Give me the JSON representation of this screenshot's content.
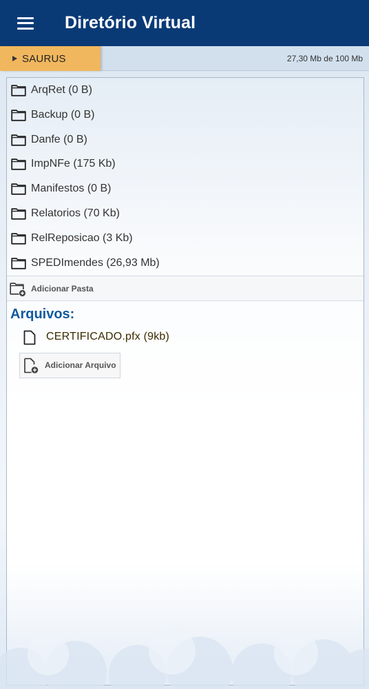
{
  "header": {
    "title": "Diretório Virtual",
    "menu_icon": "hamburger-menu-icon"
  },
  "subbar": {
    "current": "SAURUS",
    "quota": "27,30 Mb de 100 Mb"
  },
  "folders": [
    {
      "label": "ArqRet (0 B)"
    },
    {
      "label": "Backup (0 B)"
    },
    {
      "label": "Danfe (0 B)"
    },
    {
      "label": "ImpNFe (175 Kb)"
    },
    {
      "label": "Manifestos (0 B)"
    },
    {
      "label": "Relatorios (70 Kb)"
    },
    {
      "label": "RelReposicao (3 Kb)"
    },
    {
      "label": "SPEDImendes (26,93 Mb)"
    }
  ],
  "add_folder": {
    "label": "Adicionar Pasta"
  },
  "files": {
    "heading": "Arquivos:",
    "items": [
      {
        "label": "CERTIFICADO.pfx (9kb)"
      }
    ],
    "add_label": "Adicionar Arquivo"
  },
  "colors": {
    "header_bg": "#0a3a76",
    "tab_bg": "#f0b75e",
    "heading": "#0e5a9e"
  }
}
